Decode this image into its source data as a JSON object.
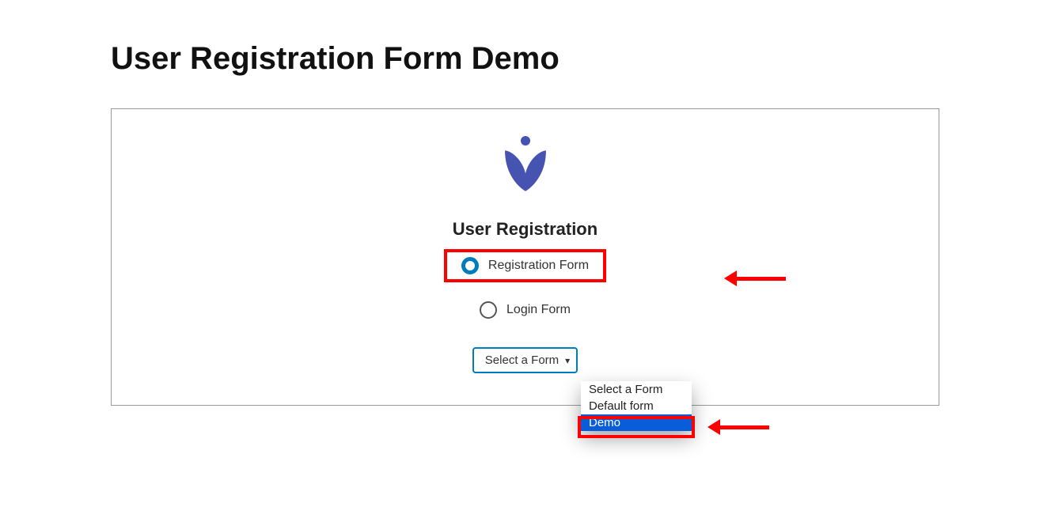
{
  "page": {
    "title": "User Registration Form Demo"
  },
  "panel": {
    "section_title": "User Registration",
    "radios": {
      "registration": {
        "label": "Registration Form",
        "selected": true
      },
      "login": {
        "label": "Login Form",
        "selected": false
      }
    },
    "select": {
      "display": "Select a Form"
    },
    "dropdown": {
      "options": [
        {
          "label": "Select a Form",
          "highlighted": false
        },
        {
          "label": "Default form",
          "highlighted": false
        },
        {
          "label": "Demo",
          "highlighted": true
        }
      ]
    }
  }
}
